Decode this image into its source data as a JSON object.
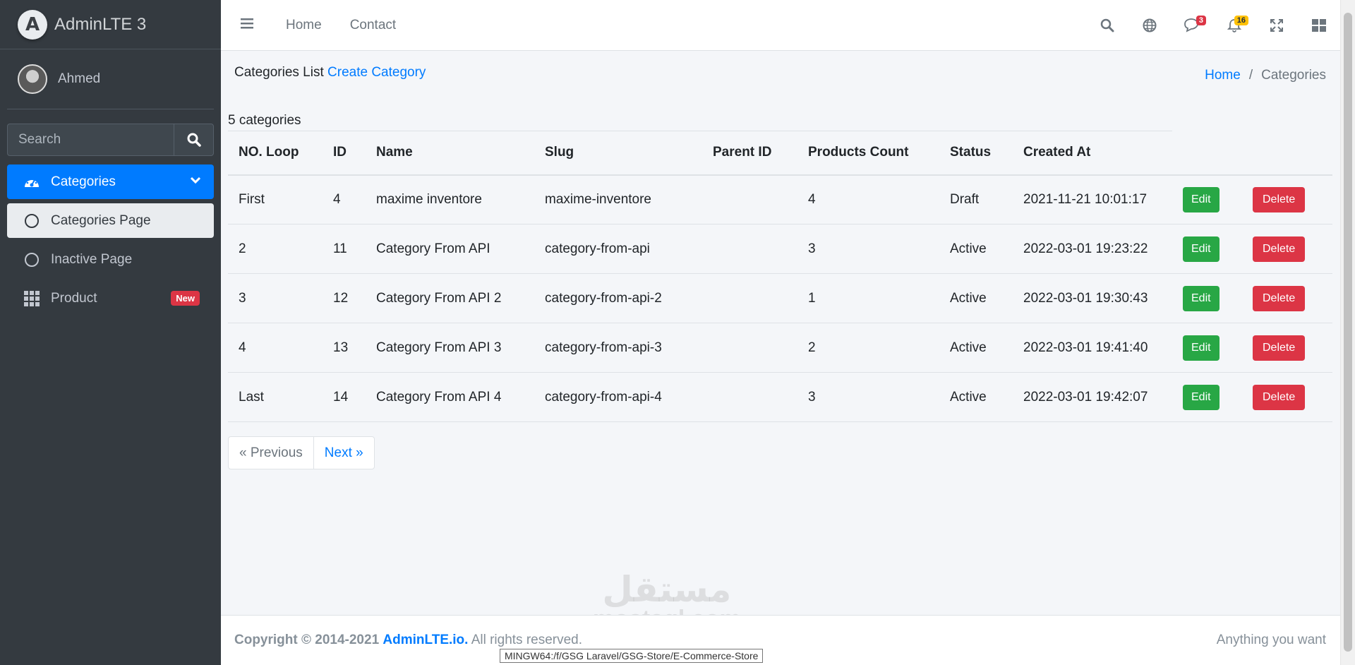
{
  "brand": {
    "name": "AdminLTE 3",
    "logo_letter": "A"
  },
  "user": {
    "name": "Ahmed"
  },
  "sidebar": {
    "search_placeholder": "Search",
    "items": [
      {
        "label": "Categories",
        "icon": "tachometer-icon"
      },
      {
        "label": "Categories Page",
        "icon": "circle-icon"
      },
      {
        "label": "Inactive Page",
        "icon": "circle-icon"
      },
      {
        "label": "Product",
        "icon": "grid-icon",
        "badge": "New"
      }
    ]
  },
  "navbar": {
    "links": [
      "Home",
      "Contact"
    ],
    "messages_count": "3",
    "notifications_count": "16"
  },
  "content": {
    "title": "Categories List",
    "create_link": "Create Category",
    "breadcrumb": {
      "home": "Home",
      "sep": "/",
      "current": "Categories"
    },
    "count_text": "5 categories"
  },
  "table": {
    "headers": [
      "NO. Loop",
      "ID",
      "Name",
      "Slug",
      "Parent ID",
      "Products Count",
      "Status",
      "Created At"
    ],
    "rows": [
      {
        "loop": "First",
        "id": "4",
        "name": "maxime inventore",
        "slug": "maxime-inventore",
        "parent": "",
        "count": "4",
        "status": "Draft",
        "created": "2021-11-21 10:01:17"
      },
      {
        "loop": "2",
        "id": "11",
        "name": "Category From API",
        "slug": "category-from-api",
        "parent": "",
        "count": "3",
        "status": "Active",
        "created": "2022-03-01 19:23:22"
      },
      {
        "loop": "3",
        "id": "12",
        "name": "Category From API 2",
        "slug": "category-from-api-2",
        "parent": "",
        "count": "1",
        "status": "Active",
        "created": "2022-03-01 19:30:43"
      },
      {
        "loop": "4",
        "id": "13",
        "name": "Category From API 3",
        "slug": "category-from-api-3",
        "parent": "",
        "count": "2",
        "status": "Active",
        "created": "2022-03-01 19:41:40"
      },
      {
        "loop": "Last",
        "id": "14",
        "name": "Category From API 4",
        "slug": "category-from-api-4",
        "parent": "",
        "count": "3",
        "status": "Active",
        "created": "2022-03-01 19:42:07"
      }
    ],
    "edit_label": "Edit",
    "delete_label": "Delete"
  },
  "pagination": {
    "prev": "« Previous",
    "next": "Next »"
  },
  "footer": {
    "copyright_prefix": "Copyright © 2014-2021",
    "brand_link": "AdminLTE.io.",
    "suffix": "All rights reserved.",
    "right": "Anything you want"
  },
  "tooltip": "MINGW64:/f/GSG Laravel/GSG-Store/E-Commerce-Store",
  "watermark": {
    "arabic": "مستقل",
    "latin": "mostaql.com"
  },
  "colors": {
    "primary": "#007bff",
    "success": "#28a745",
    "danger": "#dc3545",
    "sidebar": "#343a40"
  }
}
